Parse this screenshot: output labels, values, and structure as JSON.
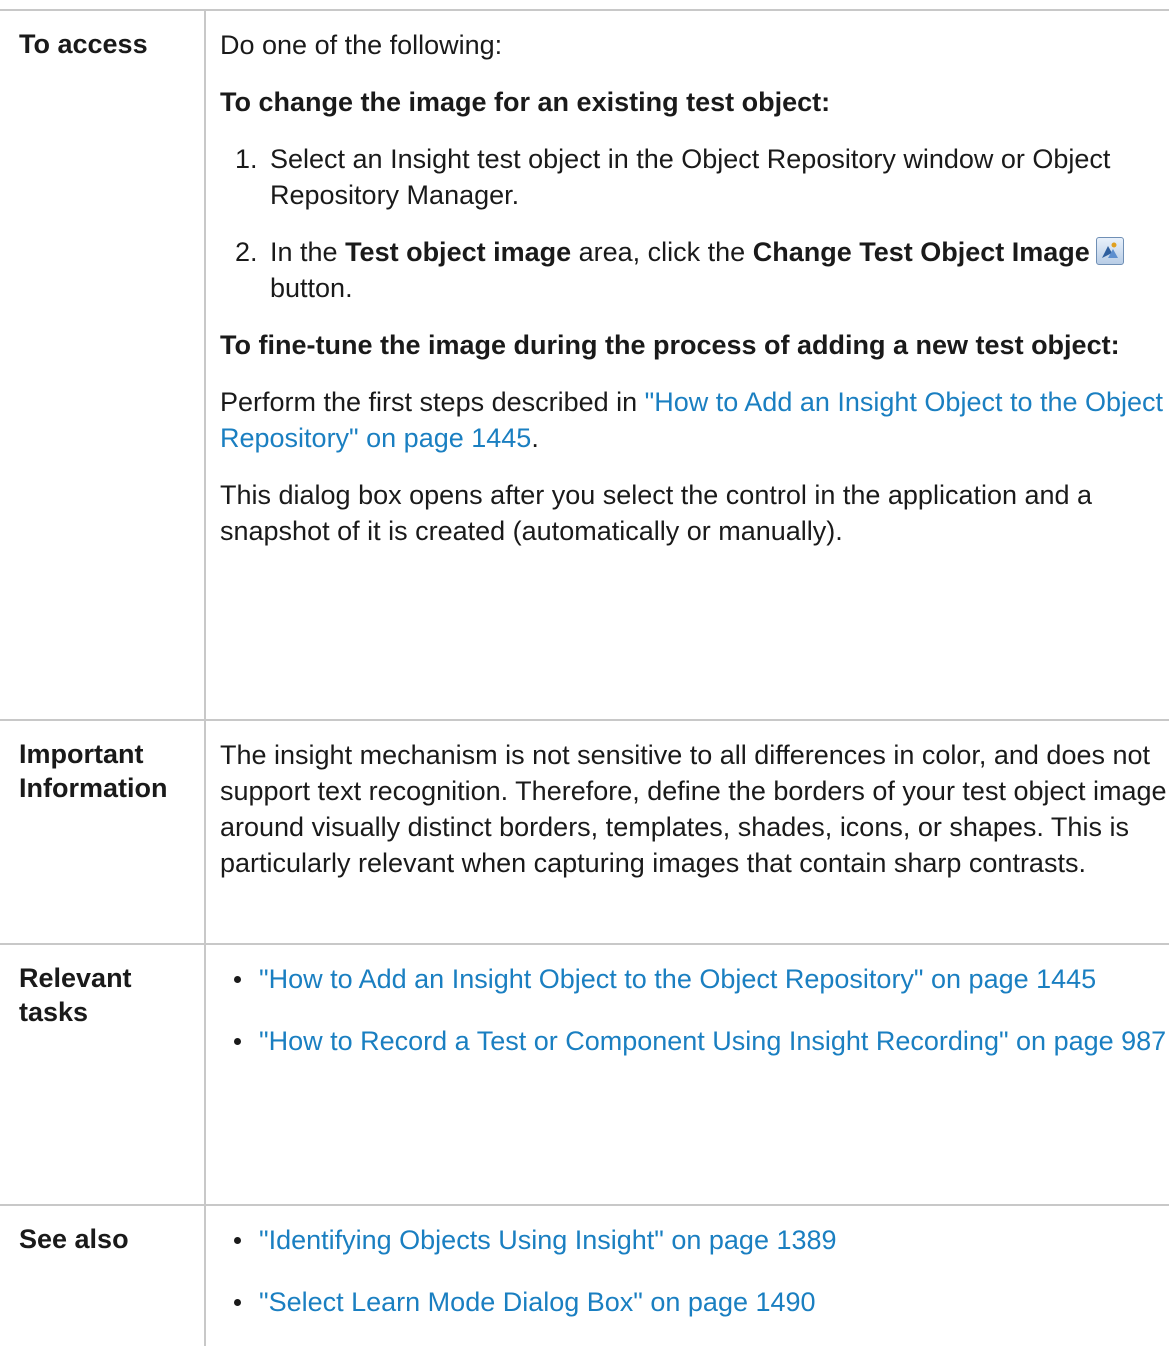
{
  "rows": {
    "access": {
      "label": "To access",
      "intro": "Do one of the following:",
      "existing_heading": "To change the image for an existing test object:",
      "step1": "Select an Insight test object in the Object Repository window or Object Repository Manager.",
      "step2": {
        "prefix": "In the ",
        "bold1": "Test object image",
        "middle": " area, click the ",
        "bold2": "Change Test Object Image",
        "suffix": " button."
      },
      "finetune_heading": "To fine-tune the image during the process of adding a new test object:",
      "perform_prefix": "Perform the first steps described in ",
      "perform_link": "\"How to Add an Insight Object to the Object Repository\" on page 1445",
      "perform_suffix": ".",
      "dialog_note": "This dialog box opens after you select the control in the application and a snapshot of it is created (automatically or manually)."
    },
    "important": {
      "label": "Important Information",
      "text": "The insight mechanism is not sensitive to all differences in color, and does not support text recognition. Therefore, define the borders of your test object image around visually distinct borders, templates, shades, icons, or shapes. This is particularly relevant when capturing images that contain sharp contrasts."
    },
    "tasks": {
      "label": "Relevant tasks",
      "links": [
        "\"How to Add an Insight Object to the Object Repository\" on page 1445",
        "\"How to Record a Test or Component Using Insight Recording\" on page 987"
      ]
    },
    "see_also": {
      "label": "See also",
      "links": [
        "\"Identifying Objects Using Insight\" on page 1389",
        "\"Select Learn Mode Dialog Box\" on page 1490"
      ]
    }
  },
  "colors": {
    "link": "#1a7fc1",
    "text": "#1a1a1a",
    "border": "#c8c8c8"
  },
  "icons": {
    "change_image": "change-test-object-image-icon"
  }
}
